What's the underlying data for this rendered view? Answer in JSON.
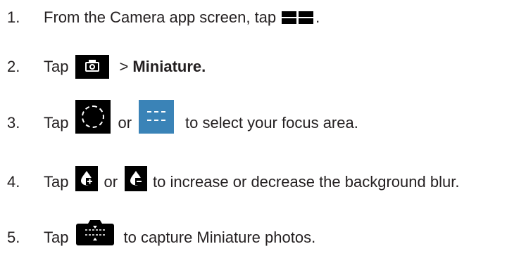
{
  "steps": [
    {
      "number": "1.",
      "text_before": "From the Camera app screen, tap",
      "icon": "grid-menu-icon",
      "text_after": "."
    },
    {
      "number": "2.",
      "text_before": "Tap",
      "icon": "camera-settings-icon",
      "separator": ">",
      "bold_text": "Miniature."
    },
    {
      "number": "3.",
      "text_before": "Tap",
      "icon": "circle-focus-icon",
      "connector": "or",
      "icon2": "linear-focus-icon",
      "text_after": "to select your focus area."
    },
    {
      "number": "4.",
      "text_before": "Tap",
      "icon": "blur-increase-icon",
      "connector": "or",
      "icon2": "blur-decrease-icon",
      "text_after": "to increase or decrease the background blur."
    },
    {
      "number": "5.",
      "text_before": "Tap",
      "icon": "capture-miniature-icon",
      "text_after": "to capture Miniature photos."
    }
  ],
  "colors": {
    "text": "#231f20",
    "icon_dark": "#000000",
    "icon_blue": "#3a83b7"
  }
}
